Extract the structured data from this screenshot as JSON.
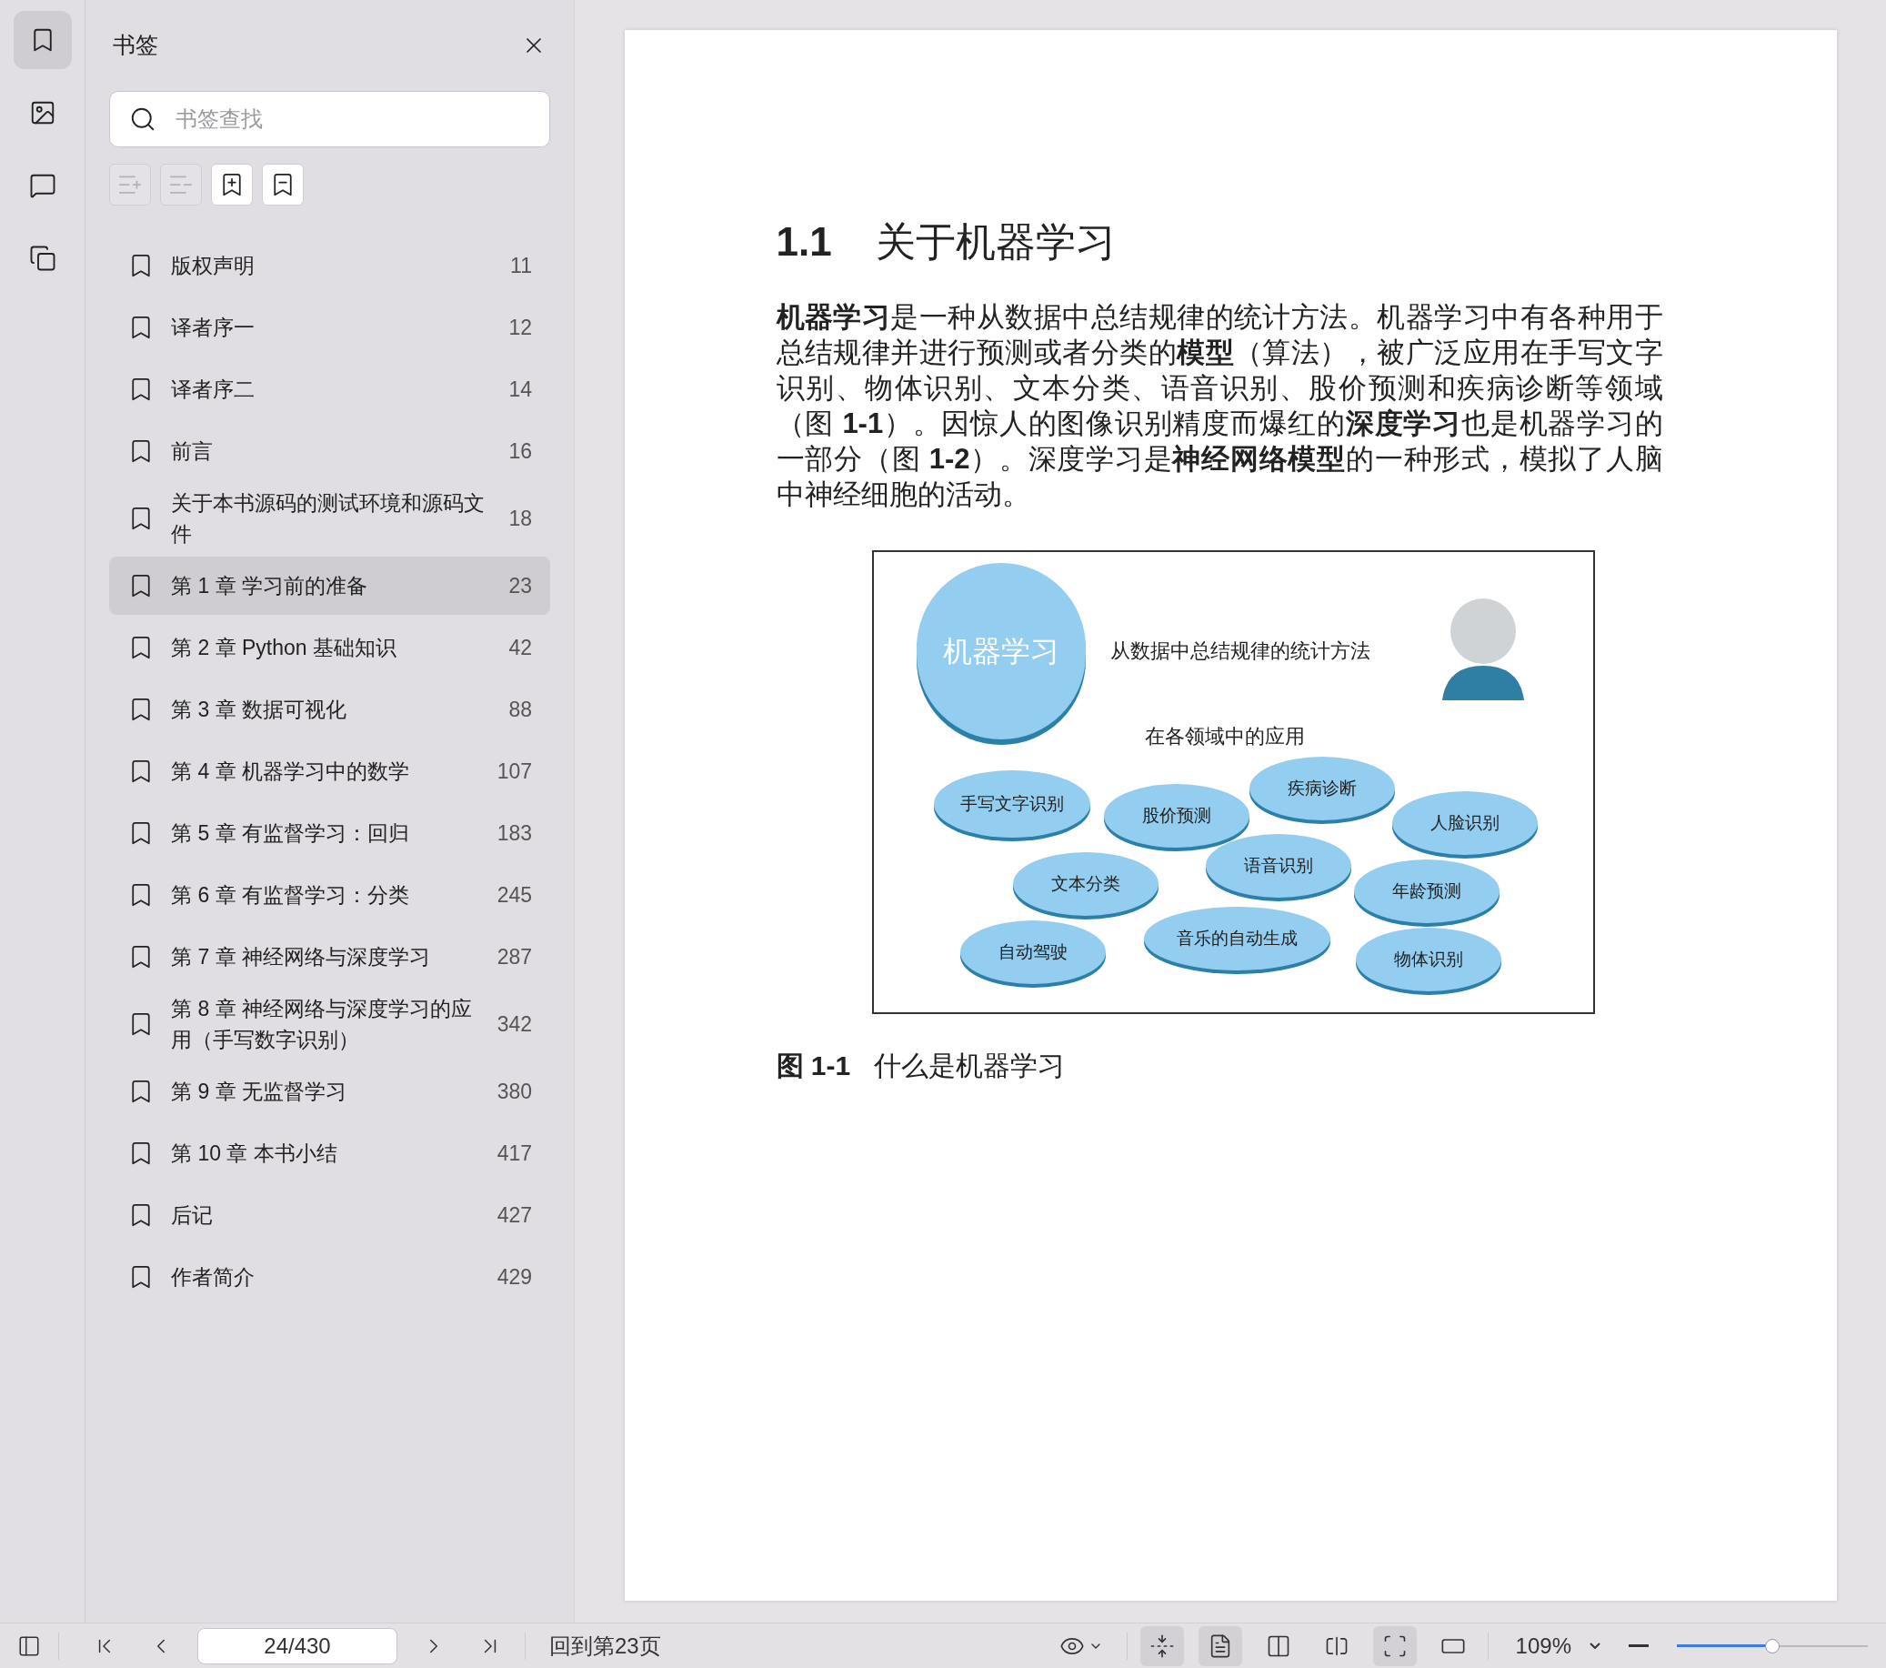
{
  "rail": [
    {
      "kind": "bookmark",
      "selected": true
    },
    {
      "kind": "image",
      "selected": false
    },
    {
      "kind": "comment",
      "selected": false
    },
    {
      "kind": "copy",
      "selected": false
    }
  ],
  "sidebar": {
    "title": "书签",
    "search": {
      "placeholder": "书签查找"
    },
    "tools": [
      {
        "kind": "expand",
        "disabled": true
      },
      {
        "kind": "collapse",
        "disabled": true
      },
      {
        "kind": "add",
        "disabled": false
      },
      {
        "kind": "remove",
        "disabled": false
      }
    ],
    "bookmarks": [
      {
        "title": "版权声明",
        "page": "11",
        "selected": false
      },
      {
        "title": "译者序一",
        "page": "12",
        "selected": false
      },
      {
        "title": "译者序二",
        "page": "14",
        "selected": false
      },
      {
        "title": "前言",
        "page": "16",
        "selected": false
      },
      {
        "title": "关于本书源码的测试环境和源码文件",
        "page": "18",
        "selected": false
      },
      {
        "title": "第 1 章 学习前的准备",
        "page": "23",
        "selected": true
      },
      {
        "title": "第 2 章 Python 基础知识",
        "page": "42",
        "selected": false
      },
      {
        "title": "第 3 章 数据可视化",
        "page": "88",
        "selected": false
      },
      {
        "title": "第 4 章 机器学习中的数学",
        "page": "107",
        "selected": false
      },
      {
        "title": "第 5 章 有监督学习：回归",
        "page": "183",
        "selected": false
      },
      {
        "title": "第 6 章 有监督学习：分类",
        "page": "245",
        "selected": false
      },
      {
        "title": "第 7 章 神经网络与深度学习",
        "page": "287",
        "selected": false
      },
      {
        "title": "第 8 章 神经网络与深度学习的应用（手写数字识别）",
        "page": "342",
        "selected": false
      },
      {
        "title": "第 9 章 无监督学习",
        "page": "380",
        "selected": false
      },
      {
        "title": "第 10 章 本书小结",
        "page": "417",
        "selected": false
      },
      {
        "title": "后记",
        "page": "427",
        "selected": false
      },
      {
        "title": "作者简介",
        "page": "429",
        "selected": false
      }
    ]
  },
  "document": {
    "heading_number": "1.1",
    "heading": "关于机器学习",
    "paragraph": "**机器学习**是一种从数据中总结规律的统计方法。机器学习中有各种用于总结规律并进行预测或者分类的**模型**（算法），被广泛应用在手写文字识别、物体识别、文本分类、语音识别、股价预测和疾病诊断等领域（图 **1-1**）。因惊人的图像识别精度而爆红的**深度学习**也是机器学习的一部分（图 **1-2**）。深度学习是**神经网络模型**的一种形式，模拟了人脑中神经细胞的活动。",
    "figure": {
      "main_label": "机器学习",
      "definition": "从数据中总结规律的统计方法",
      "subtitle": "在各领域中的应用",
      "applications": [
        "手写文字识别",
        "股价预测",
        "疾病诊断",
        "人脸识别",
        "文本分类",
        "语音识别",
        "年龄预测",
        "自动驾驶",
        "音乐的自动生成",
        "物体识别"
      ]
    },
    "caption_number": "图 1-1",
    "caption": "什么是机器学习"
  },
  "status_bar": {
    "page_field": "24/430",
    "back_link": "回到第23页",
    "view_buttons": [
      {
        "kind": "fit",
        "selected": true
      },
      {
        "kind": "single",
        "selected": true
      },
      {
        "kind": "double",
        "selected": false
      },
      {
        "kind": "spread",
        "selected": false
      },
      {
        "kind": "frame",
        "selected": true
      },
      {
        "kind": "rotate",
        "selected": false
      }
    ],
    "zoom": "109%",
    "zoom_slider": {
      "level": 0.5
    }
  }
}
